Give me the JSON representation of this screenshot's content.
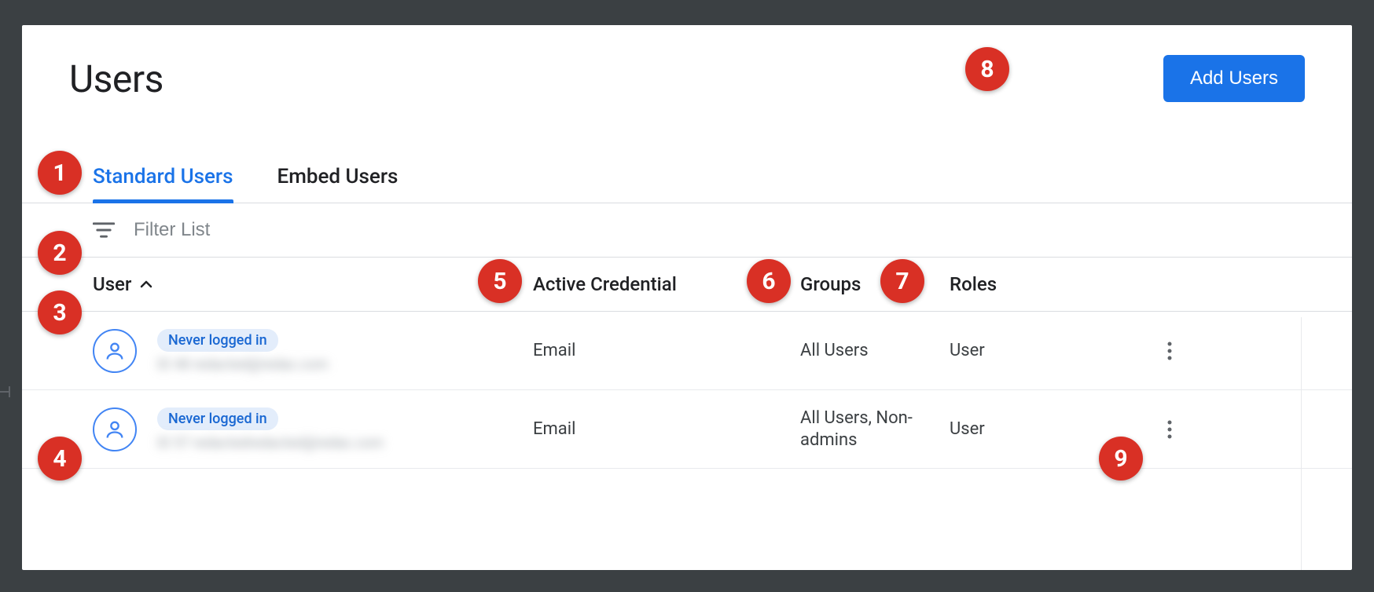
{
  "header": {
    "title": "Users",
    "addButton": "Add Users"
  },
  "tabs": {
    "standard": "Standard Users",
    "embed": "Embed Users"
  },
  "filter": {
    "placeholder": "Filter List"
  },
  "columns": {
    "user": "User",
    "credential": "Active Credential",
    "groups": "Groups",
    "roles": "Roles"
  },
  "rows": [
    {
      "badge": "Never logged in",
      "detail": "ID  48   redacted@redac.com",
      "credential": "Email",
      "groups": "All Users",
      "roles": "User"
    },
    {
      "badge": "Never logged in",
      "detail": "ID  57   redactedredacted@redac.com",
      "credential": "Email",
      "groups": "All Users, Non-admins",
      "roles": "User"
    }
  ],
  "annotations": [
    "1",
    "2",
    "3",
    "4",
    "5",
    "6",
    "7",
    "8",
    "9"
  ]
}
